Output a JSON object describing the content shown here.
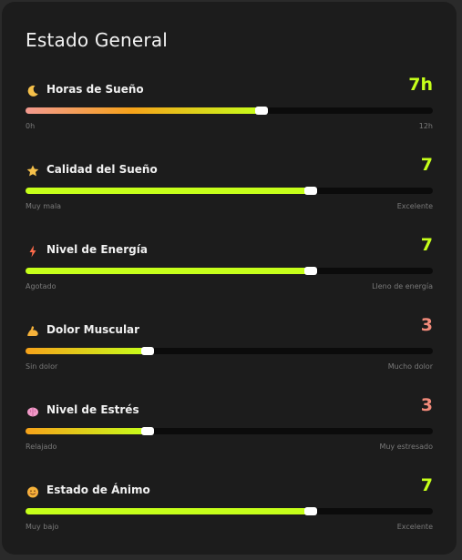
{
  "card": {
    "title": "Estado General"
  },
  "colors": {
    "accent_green": "#c6ff1a",
    "accent_coral": "#f28a7a",
    "track": "#0b0b0b"
  },
  "metrics": [
    {
      "icon": "crescent-moon-icon",
      "label": "Horas de Sueño",
      "value": "7h",
      "fraction": 0.58,
      "min_label": "0h",
      "max_label": "12h",
      "value_color": "#c6ff1a",
      "gradient": "linear-gradient(90deg,#f39a90 0%,#f6a21a 45%,#c6ff1a 100%)"
    },
    {
      "icon": "star-icon",
      "label": "Calidad del Sueño",
      "value": "7",
      "fraction": 0.7,
      "min_label": "Muy mala",
      "max_label": "Excelente",
      "value_color": "#c6ff1a",
      "gradient": "linear-gradient(90deg,#c6ff1a,#c6ff1a)"
    },
    {
      "icon": "lightning-icon",
      "label": "Nivel de Energía",
      "value": "7",
      "fraction": 0.7,
      "min_label": "Agotado",
      "max_label": "Lleno de energía",
      "value_color": "#c6ff1a",
      "gradient": "linear-gradient(90deg,#c6ff1a,#c6ff1a)"
    },
    {
      "icon": "flexed-bicep-icon",
      "label": "Dolor Muscular",
      "value": "3",
      "fraction": 0.3,
      "min_label": "Sin dolor",
      "max_label": "Mucho dolor",
      "value_color": "#f28a7a",
      "gradient": "linear-gradient(90deg,#f6a21a 0%,#c6ff1a 100%)"
    },
    {
      "icon": "brain-icon",
      "label": "Nivel de Estrés",
      "value": "3",
      "fraction": 0.3,
      "min_label": "Relajado",
      "max_label": "Muy estresado",
      "value_color": "#f28a7a",
      "gradient": "linear-gradient(90deg,#f6a21a 0%,#c6ff1a 100%)"
    },
    {
      "icon": "smiling-face-icon",
      "label": "Estado de Ánimo",
      "value": "7",
      "fraction": 0.7,
      "min_label": "Muy bajo",
      "max_label": "Excelente",
      "value_color": "#c6ff1a",
      "gradient": "linear-gradient(90deg,#c6ff1a,#c6ff1a)"
    }
  ]
}
